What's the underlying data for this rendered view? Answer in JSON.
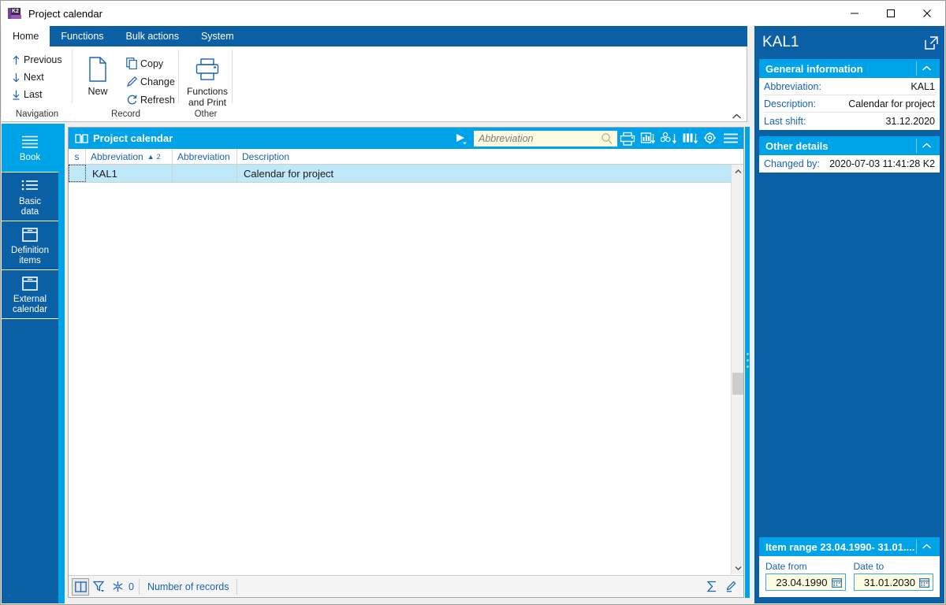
{
  "window": {
    "title": "Project calendar",
    "app_icon": "k2-logo-icon",
    "minimize_label": "Minimize",
    "maximize_label": "Maximize",
    "close_label": "Close"
  },
  "ribbon": {
    "tabs": [
      {
        "label": "Home",
        "active": true
      },
      {
        "label": "Functions",
        "active": false
      },
      {
        "label": "Bulk actions",
        "active": false
      },
      {
        "label": "System",
        "active": false
      }
    ],
    "groups": [
      {
        "name": "Navigation",
        "items": [
          {
            "label": "Previous",
            "icon": "arrow-up-icon"
          },
          {
            "label": "Next",
            "icon": "arrow-down-icon"
          },
          {
            "label": "Last",
            "icon": "arrow-down-to-line-icon"
          }
        ]
      },
      {
        "name": "Record",
        "big": {
          "label": "New",
          "icon": "new-document-icon"
        },
        "items": [
          {
            "label": "Copy",
            "icon": "copy-icon"
          },
          {
            "label": "Change",
            "icon": "pencil-icon"
          },
          {
            "label": "Refresh",
            "icon": "refresh-icon"
          }
        ]
      },
      {
        "name": "Other",
        "big": {
          "label": "Functions\nand Print",
          "label_line1": "Functions",
          "label_line2": "and Print",
          "icon": "printer-icon"
        }
      }
    ],
    "collapse_icon": "chevron-up-icon"
  },
  "sidebar": {
    "items": [
      {
        "label": "Book",
        "icon": "book-lines-icon",
        "active": true
      },
      {
        "label_line1": "Basic",
        "label_line2": "data",
        "icon": "list-icon",
        "active": false
      },
      {
        "label_line1": "Definition",
        "label_line2": "items",
        "icon": "box-icon",
        "active": false
      },
      {
        "label_line1": "External",
        "label_line2": "calendar",
        "icon": "box-icon",
        "active": false
      }
    ]
  },
  "grid": {
    "title": "Project calendar",
    "title_icon": "book-open-icon",
    "play_icon": "play-dropdown-icon",
    "search": {
      "placeholder": "Abbreviation",
      "value": "",
      "magnifier_icon": "search-icon"
    },
    "toolbar_icons": [
      {
        "name": "print-icon"
      },
      {
        "name": "chart-export-icon"
      },
      {
        "name": "group-export-icon"
      },
      {
        "name": "columns-export-icon"
      },
      {
        "name": "settings-gear-icon"
      },
      {
        "name": "hamburger-menu-icon"
      }
    ],
    "columns": [
      {
        "label": "s",
        "key": "s"
      },
      {
        "label": "Abbreviation",
        "key": "abbr1",
        "sorted": true,
        "sort_dir": "asc",
        "sort_index": "2"
      },
      {
        "label": "Abbreviation",
        "key": "abbr2"
      },
      {
        "label": "Description",
        "key": "desc"
      }
    ],
    "rows": [
      {
        "s": "",
        "abbr1": "KAL1",
        "abbr2": "",
        "desc": "Calendar for project",
        "selected": true
      }
    ],
    "status": {
      "book_icon": "book-view-icon",
      "filter_icon": "filter-icon",
      "freeze_icon": "snowflake-icon",
      "freeze_count": "0",
      "records_label": "Number of records",
      "sum_icon": "sigma-icon",
      "edit_icon": "pencil-edit-icon"
    }
  },
  "detail": {
    "header_title": "KAL1",
    "expand_icon": "open-external-icon",
    "sections": [
      {
        "title": "General information",
        "chevron": "chevron-up-icon",
        "rows": [
          {
            "key": "Abbreviation:",
            "value": "KAL1"
          },
          {
            "key": "Description:",
            "value": "Calendar for project"
          },
          {
            "key": "Last shift:",
            "value": "31.12.2020"
          }
        ]
      },
      {
        "title": "Other details",
        "chevron": "chevron-up-icon",
        "rows": [
          {
            "key": "Changed by:",
            "value": "2020-07-03 11:41:28 K2"
          }
        ]
      }
    ],
    "item_range": {
      "title": "Item range 23.04.1990- 31.01....",
      "chevron": "chevron-up-icon",
      "date_from": {
        "label": "Date from",
        "value": "23.04.1990",
        "icon": "calendar-icon"
      },
      "date_to": {
        "label": "Date to",
        "value": "31.01.2030",
        "icon": "calendar-icon"
      }
    }
  },
  "colors": {
    "ribbon_blue": "#0b5fa5",
    "accent_cyan": "#00a2e8",
    "link_blue": "#1b62b0",
    "row_selected": "#bfe9f8",
    "input_yellow": "#fdfbe0"
  }
}
